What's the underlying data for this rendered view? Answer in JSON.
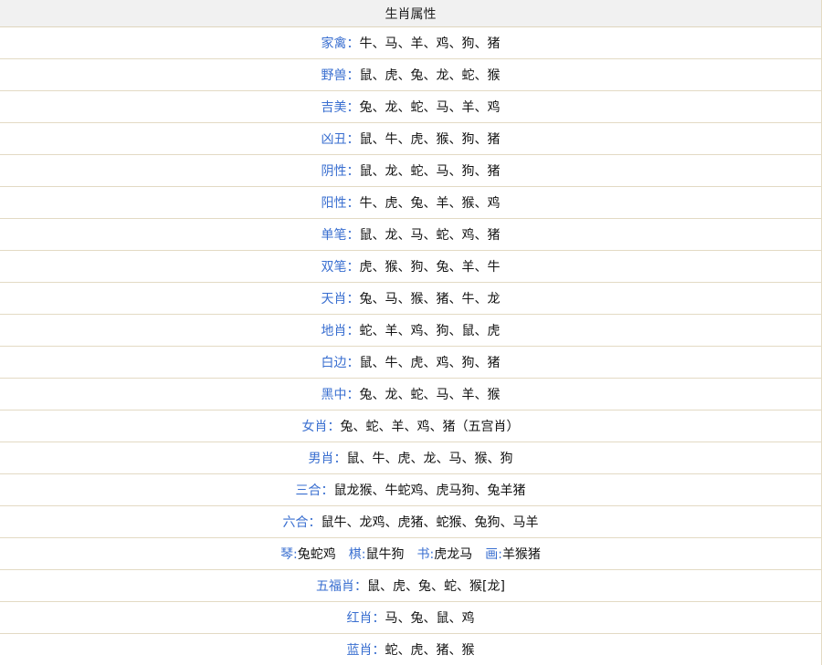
{
  "table": {
    "header": "生肖属性",
    "rows": [
      {
        "label": "家禽：",
        "value": "牛、马、羊、鸡、狗、猪"
      },
      {
        "label": "野兽：",
        "value": "鼠、虎、兔、龙、蛇、猴"
      },
      {
        "label": "吉美：",
        "value": "兔、龙、蛇、马、羊、鸡"
      },
      {
        "label": "凶丑：",
        "value": "鼠、牛、虎、猴、狗、猪"
      },
      {
        "label": "阴性：",
        "value": "鼠、龙、蛇、马、狗、猪"
      },
      {
        "label": "阳性：",
        "value": "牛、虎、兔、羊、猴、鸡"
      },
      {
        "label": "单笔：",
        "value": "鼠、龙、马、蛇、鸡、猪"
      },
      {
        "label": "双笔：",
        "value": "虎、猴、狗、兔、羊、牛"
      },
      {
        "label": "天肖：",
        "value": "兔、马、猴、猪、牛、龙"
      },
      {
        "label": "地肖：",
        "value": "蛇、羊、鸡、狗、鼠、虎"
      },
      {
        "label": "白边：",
        "value": "鼠、牛、虎、鸡、狗、猪"
      },
      {
        "label": "黑中：",
        "value": "兔、龙、蛇、马、羊、猴"
      },
      {
        "label": "女肖：",
        "value": "兔、蛇、羊、鸡、猪（五宫肖）"
      },
      {
        "label": "男肖：",
        "value": "鼠、牛、虎、龙、马、猴、狗"
      },
      {
        "label": "三合：",
        "value": "鼠龙猴、牛蛇鸡、虎马狗、兔羊猪"
      },
      {
        "label": "六合：",
        "value": "鼠牛、龙鸡、虎猪、蛇猴、兔狗、马羊"
      }
    ],
    "qin_row": {
      "qin_label": "琴:",
      "qin_value": "兔蛇鸡",
      "qi_label": "棋:",
      "qi_value": "鼠牛狗",
      "shu_label": "书:",
      "shu_value": "虎龙马",
      "hua_label": "画:",
      "hua_value": "羊猴猪"
    },
    "rows_tail": [
      {
        "label": "五福肖：",
        "value": "鼠、虎、兔、蛇、猴[龙]"
      },
      {
        "label": "红肖：",
        "value": "马、兔、鼠、鸡"
      },
      {
        "label": "蓝肖：",
        "value": "蛇、虎、猪、猴"
      }
    ]
  }
}
